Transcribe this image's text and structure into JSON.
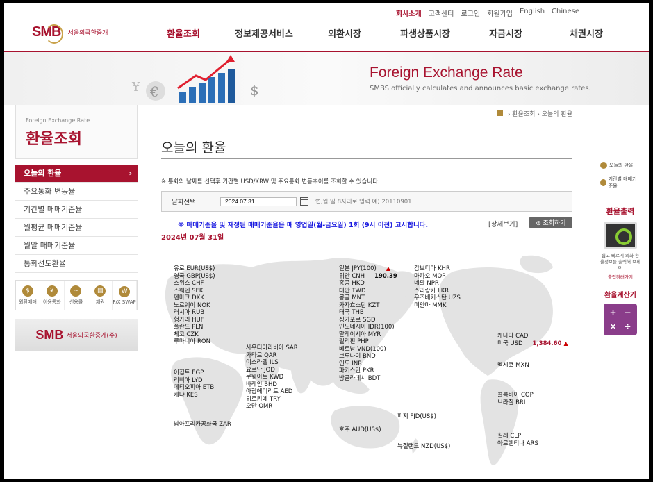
{
  "util": [
    "회사소개",
    "고객센터",
    "로그인",
    "회원가입",
    "English",
    "Chinese"
  ],
  "logo": {
    "mark": "SMB",
    "sub": "서울외국환중개"
  },
  "gnb": [
    "환율조회",
    "정보제공서비스",
    "외환시장",
    "파생상품시장",
    "자금시장",
    "채권시장"
  ],
  "banner": {
    "title": "Foreign Exchange Rate",
    "desc": "SMBS officially calculates and announces basic exchange rates."
  },
  "lnb": {
    "en": "Foreign Exchange Rate",
    "ko": "환율조회",
    "items": [
      "오늘의 환율",
      "주요통화 변동율",
      "기간별 매매기준율",
      "월평균 매매기준율",
      "월말 매매기준율",
      "통화선도환율"
    ]
  },
  "quick": [
    "외환매매",
    "이용통화",
    "신용콜",
    "채권",
    "F/X SWAP"
  ],
  "smb_box": {
    "mark": "SMB",
    "sub": "서울외국환중개(주)"
  },
  "breadcrumb": {
    "parent": "환율조회",
    "current": "오늘의 환율"
  },
  "page_title": "오늘의 환율",
  "note": "※ 통화와 날짜를 선택후 기간별 USD/KRW 및 주요통화 변동추이를 조회할 수 있습니다.",
  "date": {
    "label": "날짜선택",
    "value": "2024.07.31",
    "hint": "연,월,일 8자리로 입력 예) 20110901"
  },
  "notice": "※ 매매기준율 및 재정된 매매기준율은 매 영업일(월-금요일) 1회 (9시 이전) 고시합니다.",
  "detail_link": "[상세보기]",
  "query_button": "조회하기",
  "date_label": "2024년 07월 31일",
  "currencies": {
    "europe": [
      "유로 EUR(US$)",
      "영국 GBP(US$)",
      "스위스 CHF",
      "스웨덴 SEK",
      "덴마크 DKK",
      "노르웨이 NOK",
      "러시아 RUB",
      "헝가리 HUF",
      "폴란드 PLN",
      "체코 CZK",
      "루마니아 RON"
    ],
    "asia1": [
      "일본 JPY(100)",
      "위안 CNH",
      "홍콩 HKD",
      "대만 TWD",
      "몽골 MNT",
      "카자흐스탄 KZT",
      "태국 THB",
      "싱가포르 SGD",
      "인도네시아 IDR(100)",
      "말레이시아 MYR",
      "필리핀 PHP",
      "베트남 VND(100)",
      "브루나이 BND",
      "인도 INR",
      "파키스탄 PKR",
      "방글라데시 BDT"
    ],
    "cnh_value": "190.39",
    "asia2": [
      "캄보디아 KHR",
      "마카오 MOP",
      "네팔 NPR",
      "스리랑카 LKR",
      "우즈베키스탄 UZS",
      "미얀마 MMK"
    ],
    "mideast": [
      "사우디아라비아 SAR",
      "카타르 QAR",
      "이스라엘 ILS",
      "요르단 JOD",
      "쿠웨이트 KWD",
      "바레인 BHD",
      "아랍에미리트 AED",
      "튀르키예 TRY",
      "오만 OMR"
    ],
    "africa": [
      "이집트 EGP",
      "리비아 LYD",
      "에티오피아 ETB",
      "케냐 KES"
    ],
    "zar": "남아프리카공화국 ZAR",
    "aud": "호주 AUD(US$)",
    "fjd": "피지 FJD(US$)",
    "nzd": "뉴질랜드 NZD(US$)",
    "cad": "캐나다 CAD",
    "usd": "미국 USD",
    "usd_value": "1,384.60",
    "mxn": "멕시코 MXN",
    "latam": [
      "콜롬비아 COP",
      "브라질 BRL"
    ],
    "latam2": [
      "칠레 CLP",
      "아르헨티나 ARS"
    ]
  },
  "right": {
    "links": [
      "오늘의 환율",
      "기간별 매매기준율"
    ],
    "print_title": "환율출력",
    "print_desc": "쉽고 빠르게 외화 환율정보를 출력해 보세요.",
    "print_link": "출력하러가기",
    "calc_title": "환율계산기"
  }
}
